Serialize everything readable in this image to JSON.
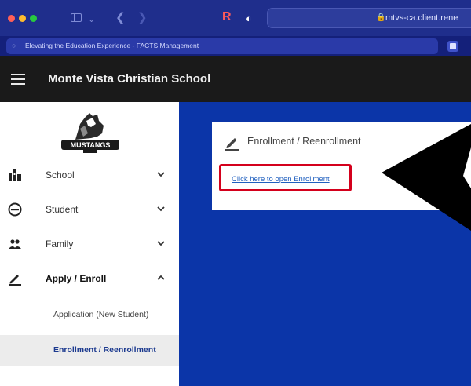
{
  "browser": {
    "address_text": "mtvs-ca.client.rene",
    "tab_title": "Elevating the Education Experience - FACTS Management",
    "icons": [
      "sidebar-toggle-icon",
      "chevron-down-icon",
      "back-arrow-icon",
      "forward-arrow-icon",
      "r-extension-icon",
      "shield-icon",
      "lock-icon"
    ]
  },
  "header": {
    "title": "Monte Vista Christian School"
  },
  "sidebar": {
    "logo_text": "MUSTANGS",
    "items": [
      {
        "label": "School",
        "icon": "school-icon",
        "expanded": false
      },
      {
        "label": "Student",
        "icon": "student-icon",
        "expanded": false
      },
      {
        "label": "Family",
        "icon": "family-icon",
        "expanded": false
      },
      {
        "label": "Apply / Enroll",
        "icon": "pencil-icon",
        "expanded": true
      }
    ],
    "sub_items": [
      {
        "label": "Application (New Student)",
        "active": false
      },
      {
        "label": "Enrollment / Reenrollment",
        "active": true
      }
    ]
  },
  "main": {
    "card_title": "Enrollment / Reenrollment",
    "link_text": "Click here to open Enrollment"
  },
  "colors": {
    "main_background": "#0b35a8",
    "header_background": "#1a1a1a",
    "highlight_border": "#d4001c",
    "link": "#1f5fbf",
    "active_sub_item_text": "#1c3a8f"
  }
}
